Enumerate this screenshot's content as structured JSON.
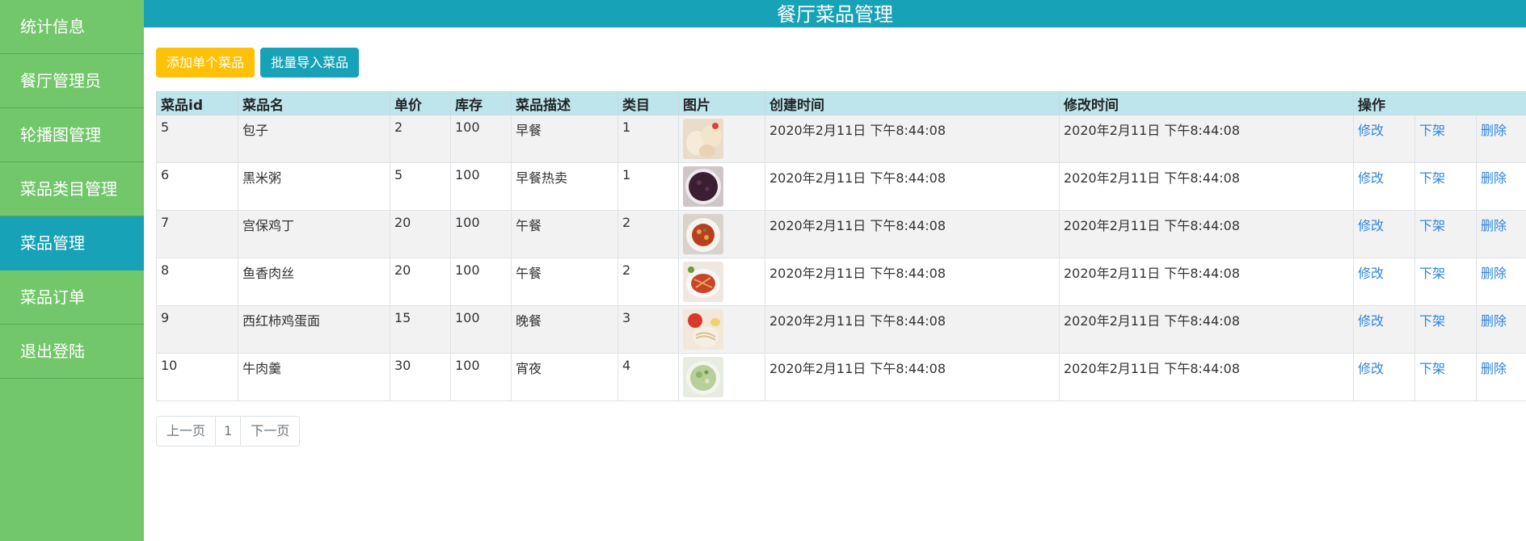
{
  "header": {
    "title": "餐厅菜品管理"
  },
  "sidebar": {
    "items": [
      {
        "label": "统计信息"
      },
      {
        "label": "餐厅管理员"
      },
      {
        "label": "轮播图管理"
      },
      {
        "label": "菜品类目管理"
      },
      {
        "label": "菜品管理",
        "active": true
      },
      {
        "label": "菜品订单"
      },
      {
        "label": "退出登陆"
      }
    ]
  },
  "toolbar": {
    "add_label": "添加单个菜品",
    "import_label": "批量导入菜品"
  },
  "table": {
    "columns": [
      "菜品id",
      "菜品名",
      "单价",
      "库存",
      "菜品描述",
      "类目",
      "图片",
      "创建时间",
      "修改时间",
      "操作"
    ],
    "action_labels": {
      "edit": "修改",
      "offshelf": "下架",
      "delete": "删除"
    },
    "rows": [
      {
        "id": "5",
        "name": "包子",
        "price": "2",
        "stock": "100",
        "desc": "早餐",
        "category": "1",
        "image": "baozi-photo",
        "created": "2020年2月11日 下午8:44:08",
        "modified": "2020年2月11日 下午8:44:08"
      },
      {
        "id": "6",
        "name": "黑米粥",
        "price": "5",
        "stock": "100",
        "desc": "早餐热卖",
        "category": "1",
        "image": "black-rice-porridge-photo",
        "created": "2020年2月11日 下午8:44:08",
        "modified": "2020年2月11日 下午8:44:08"
      },
      {
        "id": "7",
        "name": "宫保鸡丁",
        "price": "20",
        "stock": "100",
        "desc": "午餐",
        "category": "2",
        "image": "kungpao-chicken-photo",
        "created": "2020年2月11日 下午8:44:08",
        "modified": "2020年2月11日 下午8:44:08"
      },
      {
        "id": "8",
        "name": "鱼香肉丝",
        "price": "20",
        "stock": "100",
        "desc": "午餐",
        "category": "2",
        "image": "yuxiang-pork-photo",
        "created": "2020年2月11日 下午8:44:08",
        "modified": "2020年2月11日 下午8:44:08"
      },
      {
        "id": "9",
        "name": "西红柿鸡蛋面",
        "price": "15",
        "stock": "100",
        "desc": "晚餐",
        "category": "3",
        "image": "tomato-egg-noodle-photo",
        "created": "2020年2月11日 下午8:44:08",
        "modified": "2020年2月11日 下午8:44:08"
      },
      {
        "id": "10",
        "name": "牛肉羹",
        "price": "30",
        "stock": "100",
        "desc": "宵夜",
        "category": "4",
        "image": "beef-soup-photo",
        "created": "2020年2月11日 下午8:44:08",
        "modified": "2020年2月11日 下午8:44:08"
      }
    ]
  },
  "pager": {
    "prev": "上一页",
    "page": "1",
    "next": "下一页"
  }
}
